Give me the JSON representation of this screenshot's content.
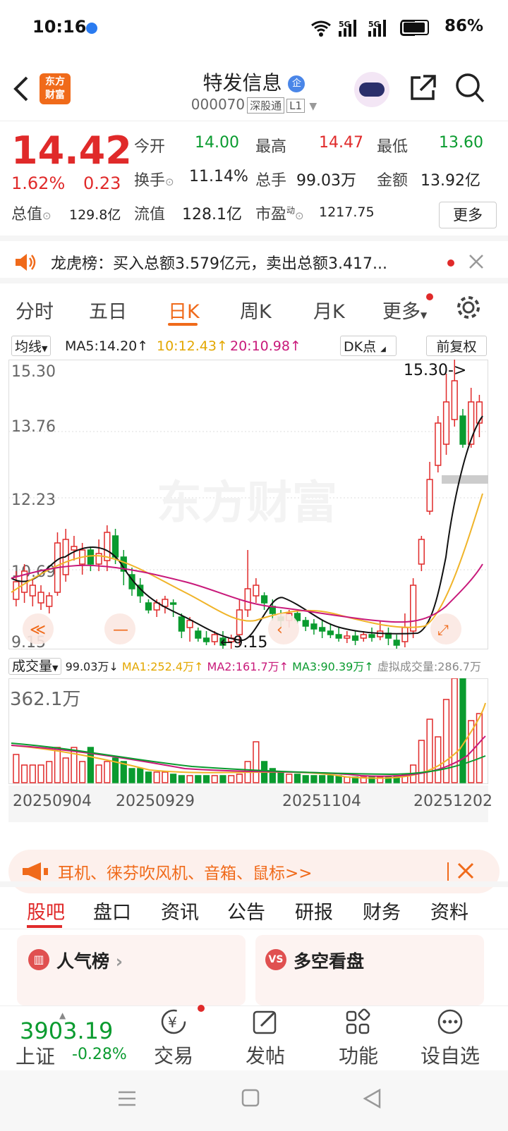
{
  "status": {
    "time": "10:16",
    "battery": "86%",
    "net1": "5G",
    "net2": "5G"
  },
  "header": {
    "title": "特发信息",
    "badge": "企",
    "code": "000070",
    "tag1": "深股通",
    "tag2": "L1"
  },
  "quote": {
    "price": "14.42",
    "pct": "1.62%",
    "chg": "0.23",
    "open_label": "今开",
    "open": "14.00",
    "high_label": "最高",
    "high": "14.47",
    "low_label": "最低",
    "low": "13.60",
    "turn_label": "换手",
    "turn": "11.14%",
    "vol_label": "总手",
    "vol": "99.03万",
    "amt_label": "金额",
    "amt": "13.92亿",
    "mcap_label": "总值",
    "mcap": "129.8亿",
    "float_label": "流值",
    "float": "128.1亿",
    "pe_label": "市盈",
    "pe_sup": "动",
    "pe": "1217.75",
    "more": "更多"
  },
  "notice": {
    "text": "龙虎榜：买入总额3.579亿元，卖出总额3.417..."
  },
  "tabs": [
    "分时",
    "五日",
    "日K",
    "周K",
    "月K",
    "更多"
  ],
  "active_tab": "日K",
  "ma": {
    "selector": "均线",
    "ma5": "MA5:14.20↑",
    "ma10": "10:12.43↑",
    "ma20": "20:10.98↑",
    "dk": "DK点",
    "fq": "前复权"
  },
  "kline": {
    "y_labels": [
      "15.30",
      "13.76",
      "12.23",
      "10.69",
      "9.15"
    ],
    "max_label": "15.30->",
    "min_label": "9.15",
    "watermark": "东方财富"
  },
  "volume": {
    "selector": "成交量",
    "v": "99.03万↓",
    "ma1": "MA1:252.4万↑",
    "ma2": "MA2:161.7万↑",
    "ma3": "MA3:90.39万↑",
    "virt": "虚拟成交量:286.7万",
    "max_label": "362.1万"
  },
  "dates": [
    "20250904",
    "20250929",
    "20251104",
    "20251202"
  ],
  "ad": {
    "text": "耳机、徕芬吹风机、音箱、鼠标>>"
  },
  "section_tabs": [
    "股吧",
    "盘口",
    "资讯",
    "公告",
    "研报",
    "财务",
    "资料"
  ],
  "cards": [
    "人气榜",
    "多空看盘"
  ],
  "bottom": {
    "index": "3903.19",
    "index_name": "上证",
    "index_chg": "-0.28%",
    "trade": "交易",
    "post": "发帖",
    "func": "功能",
    "fav": "设自选"
  },
  "colors": {
    "up": "#e02a2a",
    "down": "#0a9b2f",
    "accent": "#f06a1a"
  }
}
